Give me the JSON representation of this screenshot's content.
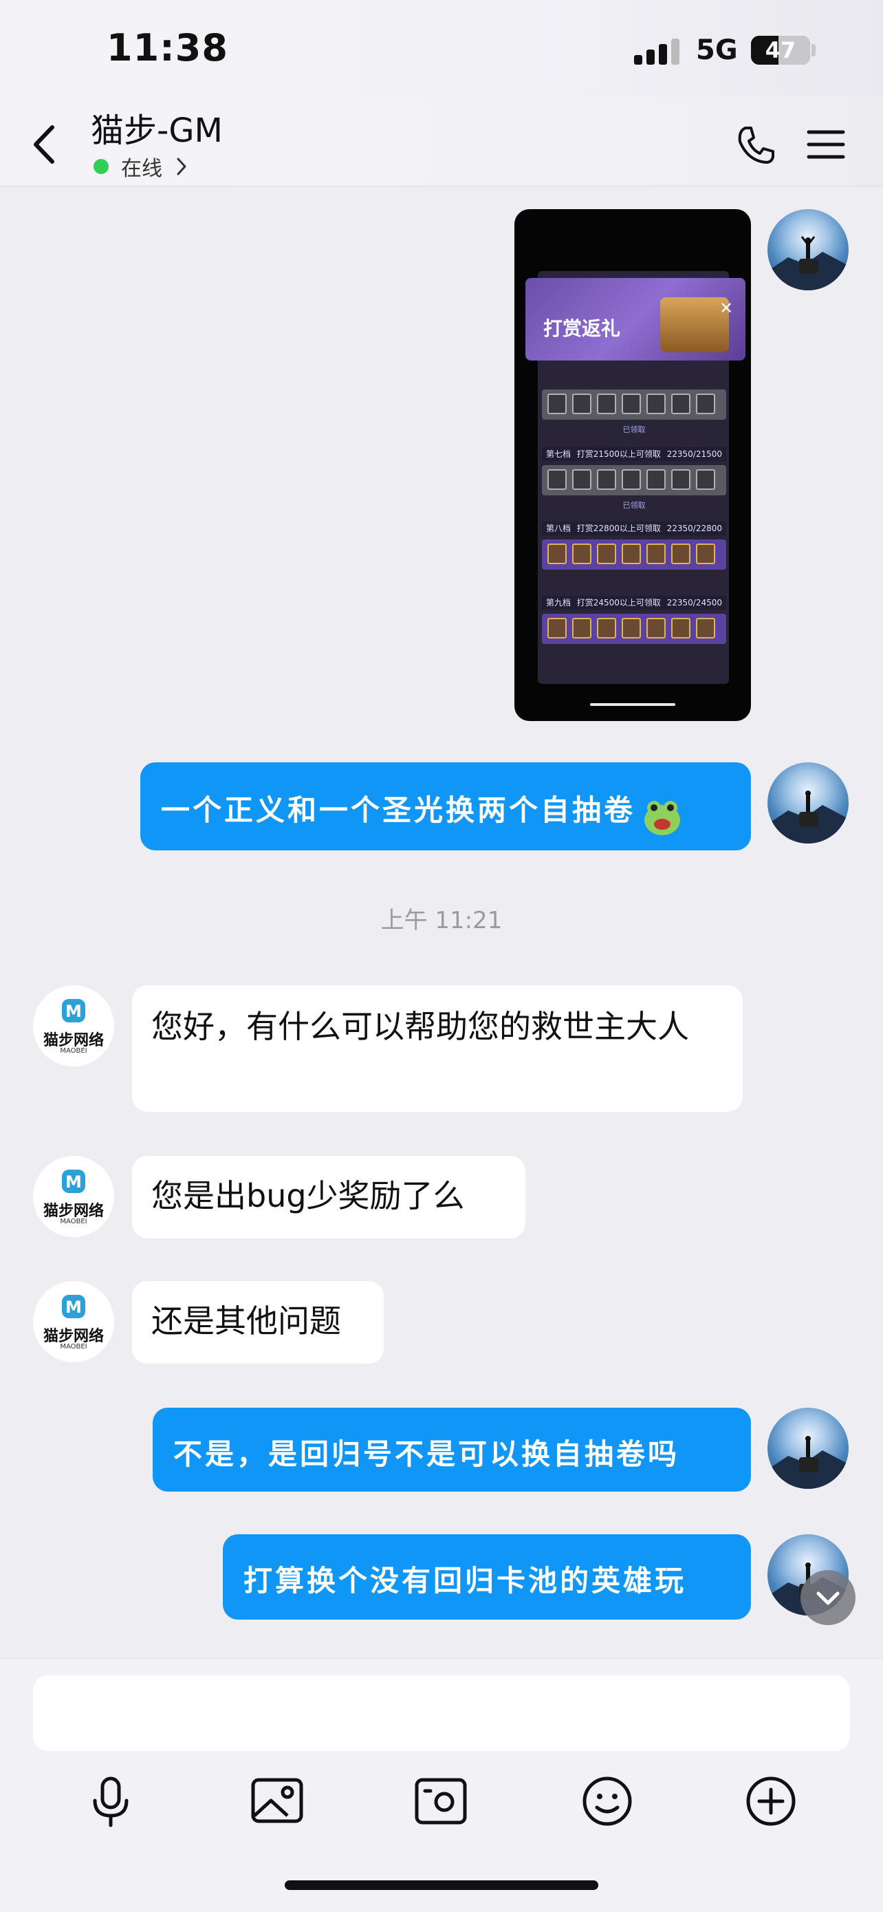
{
  "status_bar": {
    "time": "11:38",
    "network": "5G",
    "battery": "47",
    "battery_level": 0.47
  },
  "header": {
    "title": "猫步-GM",
    "status": "在线"
  },
  "image_card": {
    "banner_title": "打赏返礼",
    "rows": [
      {
        "status": "已领取"
      },
      {
        "tier": "第七档",
        "desc": "打赏21500以上可领取",
        "progress": "22350/21500",
        "status": "已领取"
      },
      {
        "tier": "第八档",
        "desc": "打赏22800以上可领取",
        "progress": "22350/22800"
      },
      {
        "tier": "第九档",
        "desc": "打赏24500以上可领取",
        "progress": "22350/24500"
      }
    ]
  },
  "messages": {
    "m1": "一个正义和一个圣光换两个自抽卷",
    "timestamp": "上午 11:21",
    "m2": "您好，有什么可以帮助您的救世主大人",
    "m3": "您是出bug少奖励了么",
    "m4": "还是其他问题",
    "m5": "不是，是回归号不是可以换自抽卷吗",
    "m6": "打算换个没有回归卡池的英雄玩"
  },
  "gm_avatar": {
    "brand": "猫步网络",
    "sub": "MAOBEI"
  },
  "input": {
    "placeholder": ""
  },
  "colors": {
    "bubble_me": "#0f96f7",
    "online": "#33cc55",
    "background": "#ededf2"
  }
}
